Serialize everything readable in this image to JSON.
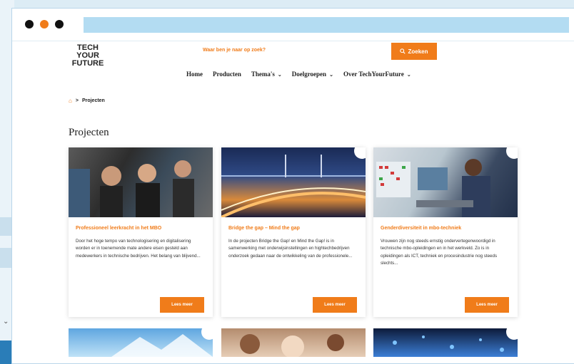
{
  "header": {
    "logo_line1": "TECH",
    "logo_line2": "YOUR",
    "logo_line3": "FUTURE",
    "search_question": "Waar ben je naar op zoek?",
    "search_button": "Zoeken",
    "search_icon": "search-icon"
  },
  "nav": {
    "items": [
      {
        "label": "Home",
        "has_dropdown": false
      },
      {
        "label": "Producten",
        "has_dropdown": false
      },
      {
        "label": "Thema's",
        "has_dropdown": true
      },
      {
        "label": "Doelgroepen",
        "has_dropdown": true
      },
      {
        "label": "Over TechYourFuture",
        "has_dropdown": true
      }
    ]
  },
  "breadcrumb": {
    "home_icon": "home-icon",
    "separator": ">",
    "current": "Projecten"
  },
  "page": {
    "title": "Projecten"
  },
  "cards": [
    {
      "title": "Professioneel leerkracht in het MBO",
      "text": "Door het hoge tempo van technologisering en digitalisering worden er in toenemende mate andere eisen gesteld aan medewerkers in technische bedrijven. Het belang van blijvend...",
      "button": "Lees meer"
    },
    {
      "title": "Bridge the gap – Mind the gap",
      "text": "In de projecten Bridge the Gap! en Mind the Gap! is in samenwerking met onderwijsinstellingen en hightechbedrijven onderzoek gedaan naar de ontwikkeling van de professionele...",
      "button": "Lees meer"
    },
    {
      "title": "Genderdiversiteit in mbo-techniek",
      "text": "Vrouwen zijn nog steeds ernstig ondervertegenwoordigd in technische mbo-opleidingen en in het werkveld. Zo is in opleidingen als ICT, techniek en procesindustrie nog steeds slechts...",
      "button": "Lees meer"
    }
  ],
  "colors": {
    "accent": "#f07c1a",
    "urlbar": "#b3dcf2"
  }
}
